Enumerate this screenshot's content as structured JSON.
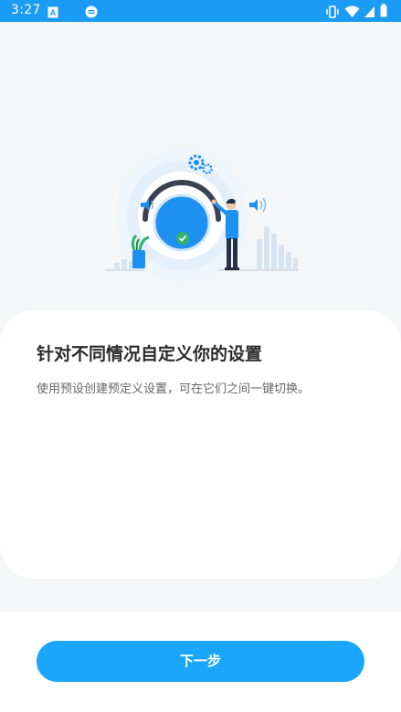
{
  "status_bar": {
    "time": "3:27",
    "background": "#1a9bf4",
    "left_icons": [
      "a-box-icon",
      "media-icon"
    ],
    "right_icons": [
      "vibrate-icon",
      "wifi-icon",
      "signal-icon",
      "battery-icon"
    ]
  },
  "illustration": {
    "description_icon": "volume-dial-illustration"
  },
  "card": {
    "title": "针对不同情况自定义你的设置",
    "description": "使用预设创建预定义设置，可在它们之间一键切换。"
  },
  "footer": {
    "next_label": "下一步",
    "accent": "#1aa6fb"
  }
}
